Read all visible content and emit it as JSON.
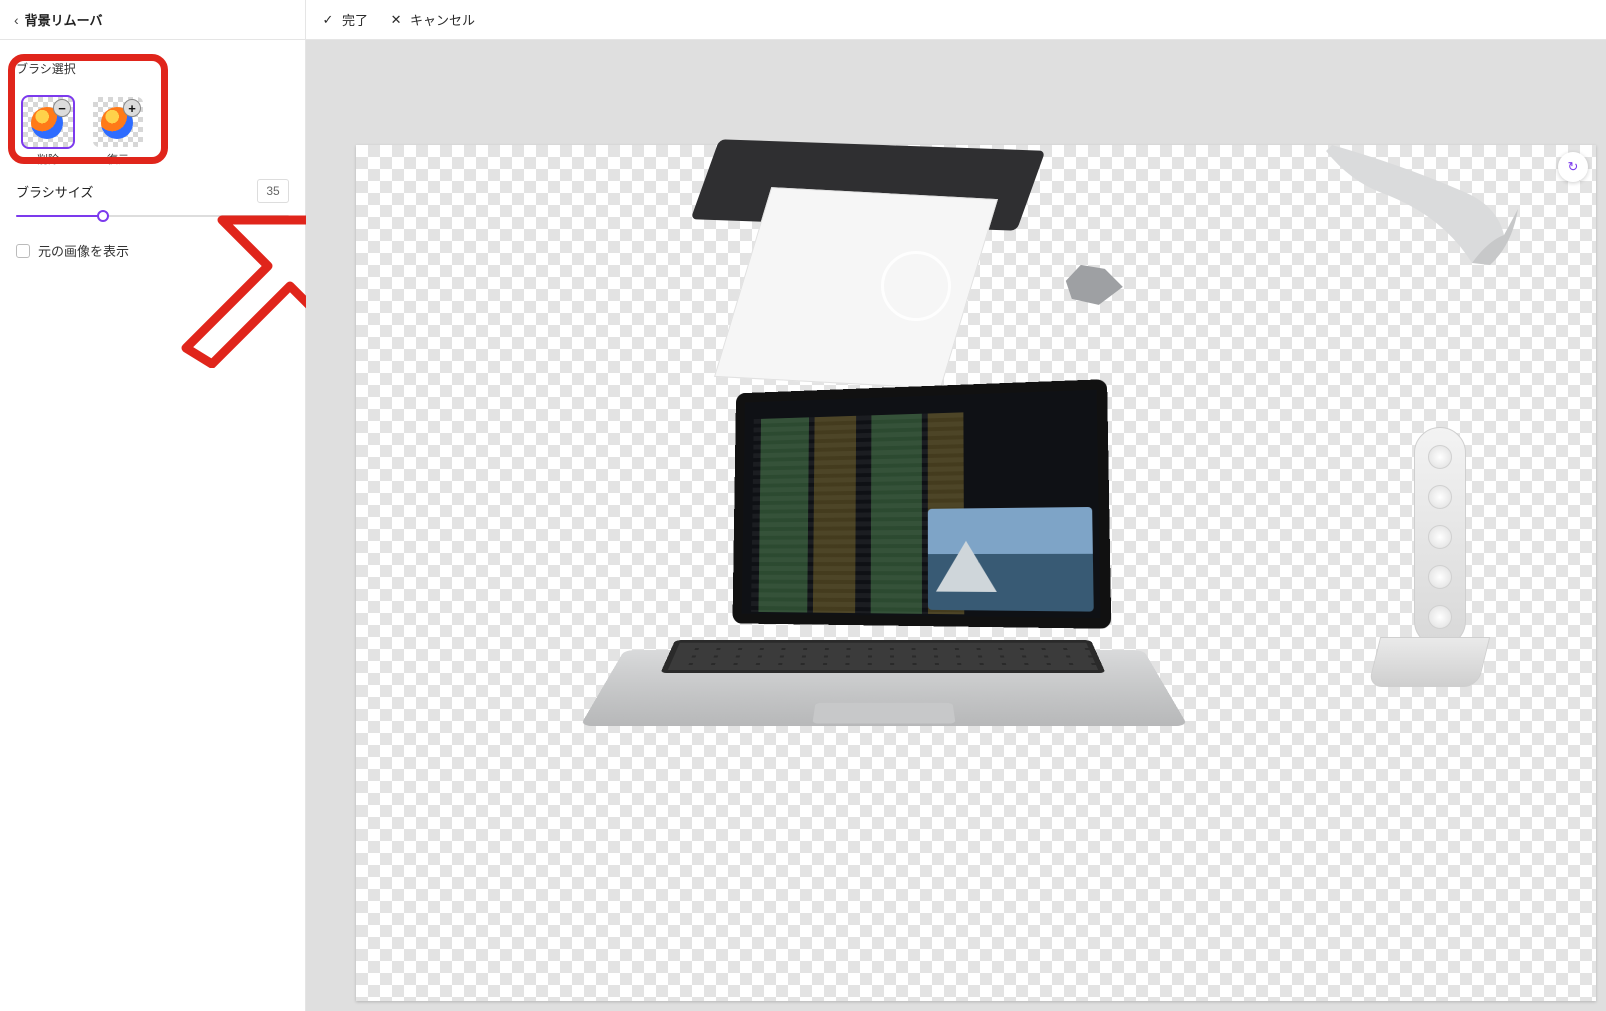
{
  "sidebar": {
    "back_label": "背景リムーバ",
    "section_hint": "ブラシ選択",
    "tiles": [
      {
        "label": "削除",
        "badge": "−",
        "selected": true
      },
      {
        "label": "復元",
        "badge": "+",
        "selected": false
      }
    ],
    "brush_size_label": "ブラシサイズ",
    "brush_size_value": "35",
    "show_original_label": "元の画像を表示",
    "show_original_checked": false
  },
  "topbar": {
    "done_label": "完了",
    "cancel_label": "キャンセル"
  },
  "icons": {
    "chevron_left": "‹",
    "check": "✓",
    "close": "✕",
    "refresh": "↻",
    "minus": "−",
    "plus": "+"
  },
  "annotation": {
    "highlight_box_hint": "brush tools",
    "arrow_color": "#e0251b"
  }
}
